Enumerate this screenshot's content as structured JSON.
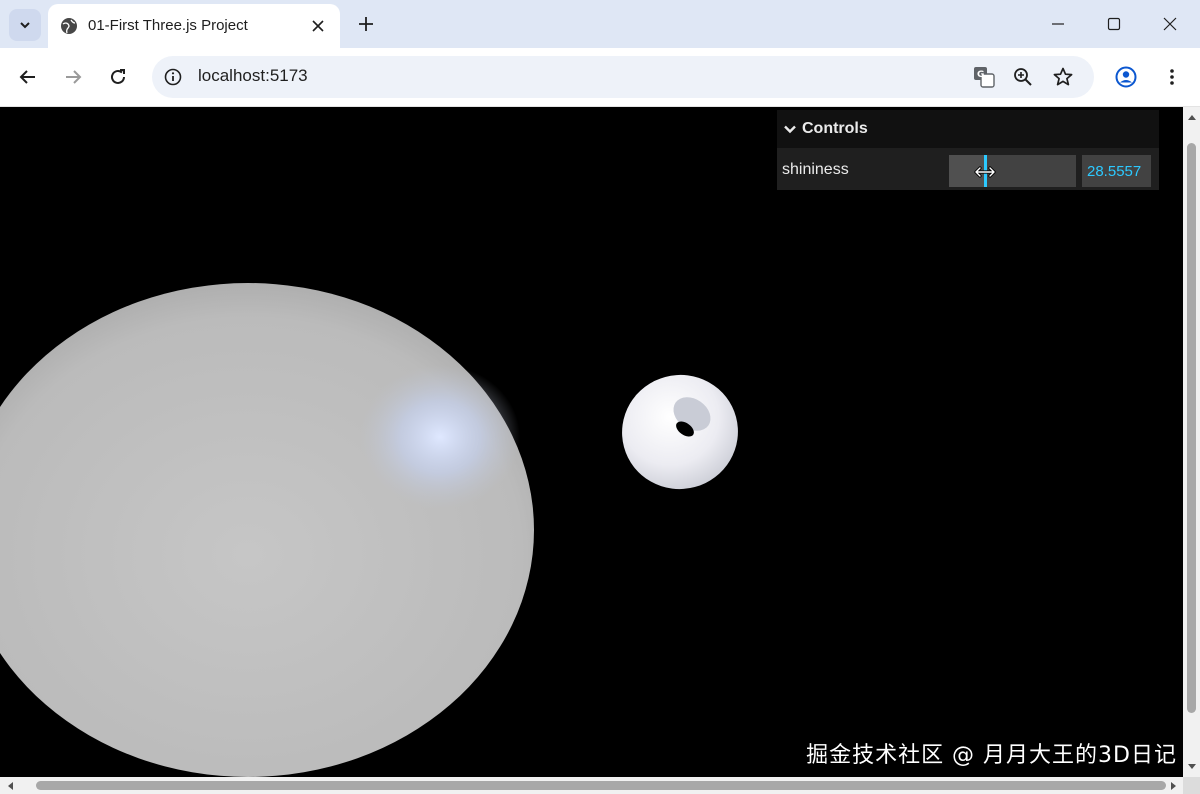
{
  "browser": {
    "tab_title": "01-First Three.js Project",
    "url": "localhost:5173"
  },
  "icons": {
    "tab_search": "chevron-down-icon",
    "favicon": "globe-icon",
    "tab_close": "close-icon",
    "new_tab": "plus-icon",
    "minimize": "minimize-icon",
    "maximize": "maximize-icon",
    "close_window": "close-icon",
    "back": "arrow-left-icon",
    "forward": "arrow-right-icon",
    "reload": "reload-icon",
    "site_info": "info-icon",
    "translate": "translate-icon",
    "zoom": "zoom-in-icon",
    "bookmark": "star-icon",
    "profile": "account-icon",
    "menu": "kebab-menu-icon"
  },
  "gui": {
    "title": "Controls",
    "controls": [
      {
        "label": "shininess",
        "value": "28.5557",
        "min": 0,
        "max": 100,
        "fraction": 0.285557
      }
    ]
  },
  "watermark": "掘金技术社区 @ 月月大王的3D日记",
  "colors": {
    "gui_accent": "#2cc9ff",
    "gui_bg": "#1f1f1f",
    "gui_title_bg": "#111111",
    "chrome_strip": "#dfe7f5",
    "omnibox": "#eef2f9"
  }
}
